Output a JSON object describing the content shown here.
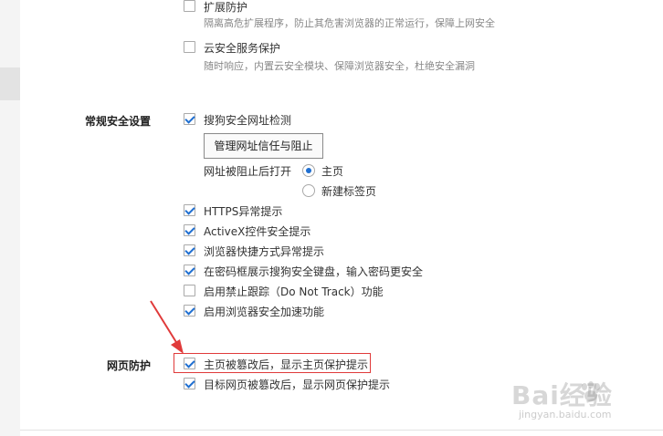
{
  "top_section": {
    "items": [
      {
        "label": "扩展防护",
        "description": "隔离高危扩展程序，防止其危害浏览器的正常运行，保障上网安全",
        "checked": false
      },
      {
        "label": "云安全服务保护",
        "description": "随时响应，内置云安全模块、保障浏览器安全，杜绝安全漏洞",
        "checked": false
      }
    ]
  },
  "general_security": {
    "title": "常规安全设置",
    "url_check": {
      "label": "搜狗安全网址检测",
      "checked": true
    },
    "manage_button": "管理网址信任与阻止",
    "blocked_open_label": "网址被阻止后打开",
    "radio_options": [
      {
        "label": "主页",
        "selected": true
      },
      {
        "label": "新建标签页",
        "selected": false
      }
    ],
    "items": [
      {
        "label": "HTTPS异常提示",
        "checked": true
      },
      {
        "label": "ActiveX控件安全提示",
        "checked": true
      },
      {
        "label": "浏览器快捷方式异常提示",
        "checked": true
      },
      {
        "label": "在密码框展示搜狗安全键盘，输入密码更安全",
        "checked": true
      },
      {
        "label": "启用禁止跟踪（Do Not Track）功能",
        "checked": false
      },
      {
        "label": "启用浏览器安全加速功能",
        "checked": true
      }
    ]
  },
  "web_protection": {
    "title": "网页防护",
    "items": [
      {
        "label": "主页被篡改后，显示主页保护提示",
        "checked": true
      },
      {
        "label": "目标网页被篡改后，显示网页保护提示",
        "checked": true
      }
    ]
  },
  "watermark": {
    "brand": "Bai经验",
    "url": "jingyan.baidu.com"
  },
  "colors": {
    "check_blue": "#1f6fd1",
    "highlight_red": "#e03a3a"
  }
}
